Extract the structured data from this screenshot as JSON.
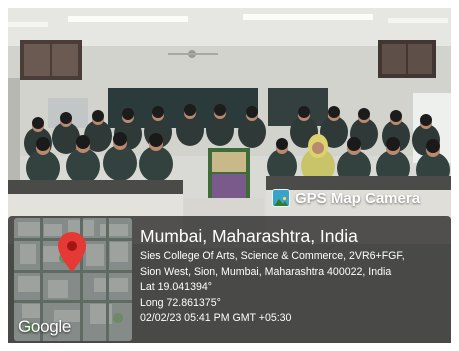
{
  "camera_badge": {
    "label": "GPS Map Camera",
    "icon": "photo-frame-icon",
    "icon_color": "#3aa3c9"
  },
  "map": {
    "watermark": "Google",
    "pin_icon": "map-pin-icon",
    "pin_color": "#e53935"
  },
  "location": {
    "city": "Mumbai, Maharashtra, India",
    "address_line1": "Sies College Of Arts, Science & Commerce, 2VR6+FGF,",
    "address_line2": "Sion West, Sion, Mumbai, Maharashtra 400022, India",
    "latitude": "Lat 19.041394°",
    "longitude": "Long 72.861375°",
    "timestamp": "02/02/23 05:41 PM GMT +05:30"
  }
}
